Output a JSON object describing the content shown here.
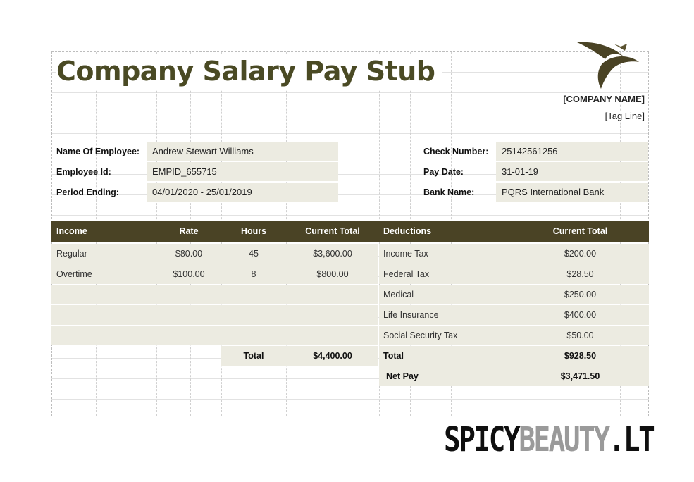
{
  "document": {
    "title": "Company Salary Pay Stub",
    "company_name": "[COMPANY NAME]",
    "tag_line": "[Tag Line]"
  },
  "employee": {
    "name_label": "Name Of Employee:",
    "name": "Andrew Stewart Williams",
    "id_label": "Employee Id:",
    "id": "EMPID_655715",
    "period_label": "Period Ending:",
    "period": "04/01/2020 - 25/01/2019"
  },
  "payment": {
    "check_label": "Check Number:",
    "check_number": "25142561256",
    "date_label": "Pay Date:",
    "date": "31-01-19",
    "bank_label": "Bank Name:",
    "bank": "PQRS International Bank"
  },
  "income": {
    "headers": [
      "Income",
      "Rate",
      "Hours",
      "Current Total"
    ],
    "rows": [
      {
        "name": "Regular",
        "rate": "$80.00",
        "hours": "45",
        "total": "$3,600.00"
      },
      {
        "name": "Overtime",
        "rate": "$100.00",
        "hours": "8",
        "total": "$800.00"
      }
    ],
    "total_label": "Total",
    "total": "$4,400.00"
  },
  "deductions": {
    "headers": [
      "Deductions",
      "Current Total"
    ],
    "rows": [
      {
        "name": "Income Tax",
        "total": "$200.00"
      },
      {
        "name": "Federal Tax",
        "total": "$28.50"
      },
      {
        "name": "Medical",
        "total": "$250.00"
      },
      {
        "name": "Life Insurance",
        "total": "$400.00"
      },
      {
        "name": "Social Security Tax",
        "total": "$50.00"
      }
    ],
    "total_label": "Total",
    "total": "$928.50",
    "net_pay_label": "Net Pay",
    "net_pay": "$3,471.50"
  },
  "watermark": {
    "dark": "SPICY",
    "light": "BEAUTY",
    "suffix": ".LT"
  },
  "colors": {
    "header_fill": "#4a4325",
    "band_fill": "#ecebe1",
    "title_color": "#4a4a24"
  }
}
